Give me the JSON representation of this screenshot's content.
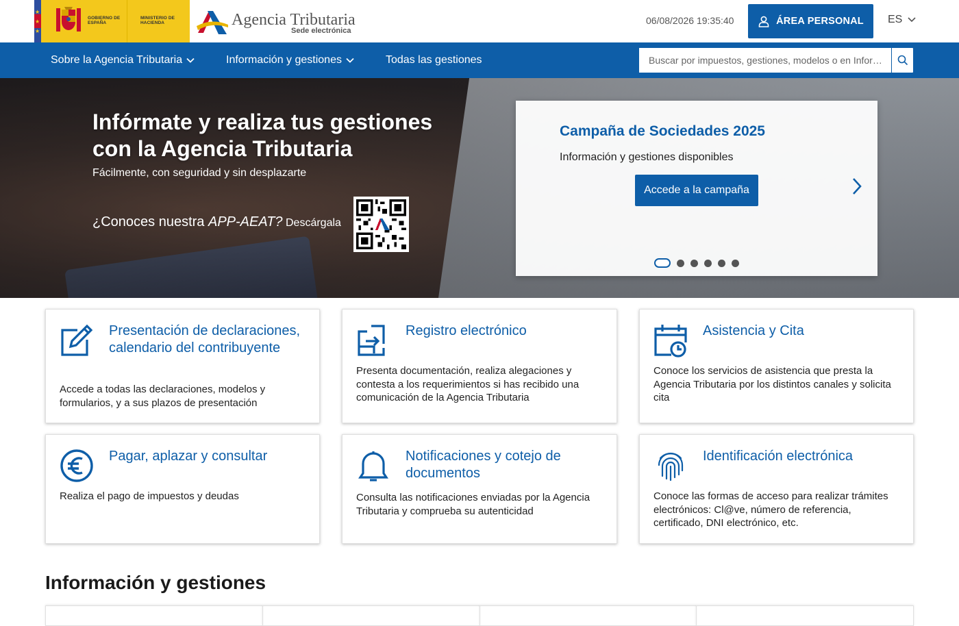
{
  "header": {
    "gov_text_1": "GOBIERNO DE ESPAÑA",
    "gov_text_2": "MINISTERIO DE HACIENDA",
    "brand_name": "Agencia Tributaria",
    "brand_sub": "Sede electrónica",
    "datetime": "06/08/2026 19:35:40",
    "area_personal": "ÁREA PERSONAL",
    "language": "ES"
  },
  "nav": {
    "items": [
      {
        "label": "Sobre la Agencia Tributaria",
        "has_dropdown": true
      },
      {
        "label": "Información y gestiones",
        "has_dropdown": true
      },
      {
        "label": "Todas las gestiones",
        "has_dropdown": false
      }
    ],
    "search_placeholder": "Buscar por impuestos, gestiones, modelos o en Infor…"
  },
  "hero": {
    "title": "Infórmate y realiza tus gestiones con la Agencia Tributaria",
    "subtitle": "Fácilmente, con seguridad y sin desplazarte",
    "app_prefix": "¿Conoces nuestra ",
    "app_name": "APP-AEAT?",
    "app_suffix": " Descárgala"
  },
  "campaign": {
    "title": "Campaña de Sociedades 2025",
    "text": "Información y gestiones disponibles",
    "button": "Accede a la campaña",
    "slide_count": 6,
    "active_slide": 1
  },
  "cards": [
    {
      "title": "Presentación de declaraciones, calendario del contribuyente",
      "desc": "Accede a todas las declaraciones, modelos y formularios, y a sus plazos de presentación",
      "icon": "edit-icon"
    },
    {
      "title": "Registro electrónico",
      "desc": "Presenta documentación, realiza alegaciones y contesta a los requerimientos si has recibido una comunicación de la Agencia Tributaria",
      "icon": "register-icon"
    },
    {
      "title": "Asistencia y Cita",
      "desc": "Conoce los servicios de asistencia que presta la Agencia Tributaria por los distintos canales y solicita cita",
      "icon": "calendar-clock-icon"
    },
    {
      "title": "Pagar, aplazar y consultar",
      "desc": "Realiza el pago de impuestos y deudas",
      "icon": "euro-icon"
    },
    {
      "title": "Notificaciones y cotejo de documentos",
      "desc": "Consulta las notificaciones enviadas por la Agencia Tributaria y comprueba su autenticidad",
      "icon": "bell-icon"
    },
    {
      "title": "Identificación electrónica",
      "desc": "Conoce las formas de acceso para realizar trámites electrónicos: Cl@ve, número de referencia, certificado, DNI electrónico, etc.",
      "icon": "fingerprint-icon"
    }
  ],
  "section": {
    "title": "Información y gestiones"
  },
  "colors": {
    "primary": "#0e5ea8",
    "gov_yellow": "#f3c81c"
  }
}
